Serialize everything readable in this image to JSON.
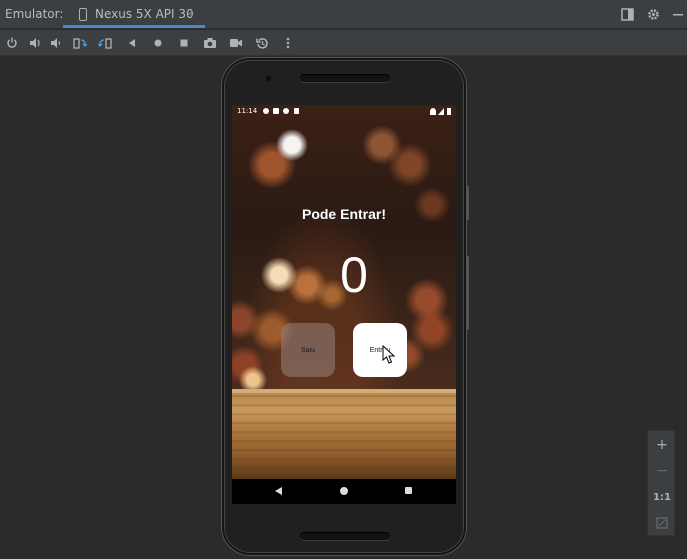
{
  "window": {
    "panel_label": "Emulator:",
    "tab_label": "Nexus 5X API 30",
    "tab_close": "×"
  },
  "toolbar": {
    "icons": [
      "power-icon",
      "volume-up-icon",
      "volume-down-icon",
      "rotate-left-icon",
      "rotate-right-icon",
      "back-icon",
      "home-icon",
      "overview-icon",
      "screenshot-icon",
      "screen-record-icon",
      "snapshot-icon",
      "more-icon"
    ]
  },
  "phone": {
    "status_time": "11:14",
    "title": "Pode Entrar!",
    "counter": "0",
    "button_left": "Saiu",
    "button_right": "Entrou"
  },
  "zoom": {
    "zoom_in": "+",
    "zoom_out": "−",
    "one_to_one": "1:1"
  },
  "colors": {
    "accent": "#4a88c7",
    "ide_bg": "#2b2b2b",
    "toolbar_bg": "#3c3f41"
  }
}
